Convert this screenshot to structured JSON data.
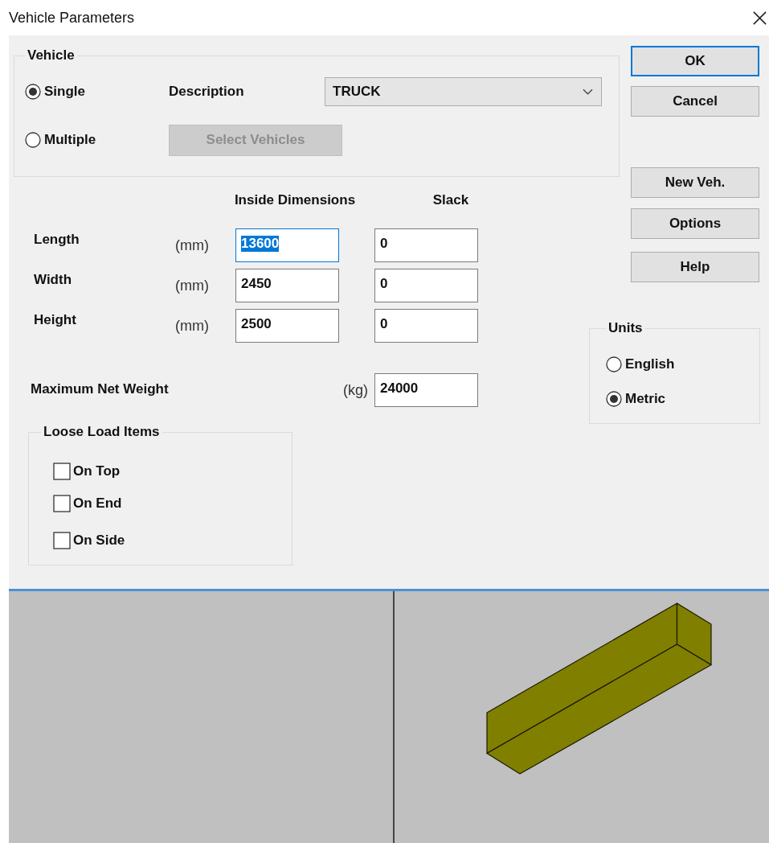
{
  "window": {
    "title": "Vehicle Parameters"
  },
  "vehicle": {
    "legend": "Vehicle",
    "modes": [
      {
        "label": "Single",
        "selected": true
      },
      {
        "label": "Multiple",
        "selected": false
      }
    ],
    "description_label": "Description",
    "description_value": "TRUCK",
    "select_button": {
      "label": "Select Vehicles",
      "disabled": true
    }
  },
  "dimensions": {
    "headers": [
      "Inside Dimensions",
      "Slack"
    ],
    "rows": [
      {
        "label": "Length",
        "unit": "(mm)",
        "value": "13600",
        "value_selected": true,
        "slack": "0"
      },
      {
        "label": "Width",
        "unit": "(mm)",
        "value": "2450",
        "value_selected": false,
        "slack": "0"
      },
      {
        "label": "Height",
        "unit": "(mm)",
        "value": "2500",
        "value_selected": false,
        "slack": "0"
      }
    ]
  },
  "max_weight": {
    "label": "Maximum Net Weight",
    "unit": "(kg)",
    "value": "24000"
  },
  "loose_load": {
    "legend": "Loose Load Items",
    "items": [
      {
        "label": "On Top",
        "checked": false
      },
      {
        "label": "On End",
        "checked": false
      },
      {
        "label": "On Side",
        "checked": false
      }
    ]
  },
  "buttons": [
    {
      "label": "OK",
      "focused": true
    },
    {
      "label": "Cancel",
      "focused": false
    },
    {
      "label": "New Veh.",
      "focused": false
    },
    {
      "label": "Options",
      "focused": false
    },
    {
      "label": "Help",
      "focused": false
    }
  ],
  "units": {
    "legend": "Units",
    "options": [
      {
        "label": "English",
        "selected": false
      },
      {
        "label": "Metric",
        "selected": true
      }
    ]
  }
}
